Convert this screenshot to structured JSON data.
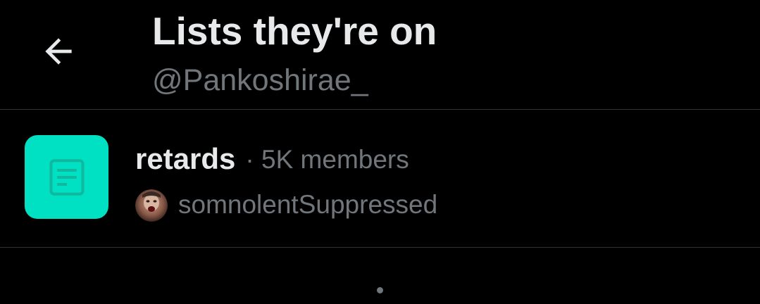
{
  "header": {
    "title": "Lists they're on",
    "handle": "@Pankoshirae_",
    "back_icon": "arrow-left-icon"
  },
  "lists": [
    {
      "name": "retards",
      "meta": "· 5K members",
      "owner": "somnolentSuppressed",
      "icon": "list-document-icon",
      "icon_bg": "#00e0c2",
      "icon_fg": "#0fb89f"
    }
  ],
  "colors": {
    "background": "#000000",
    "primary_text": "#e7e9ea",
    "secondary_text": "#71767b",
    "divider": "#2f3336"
  }
}
